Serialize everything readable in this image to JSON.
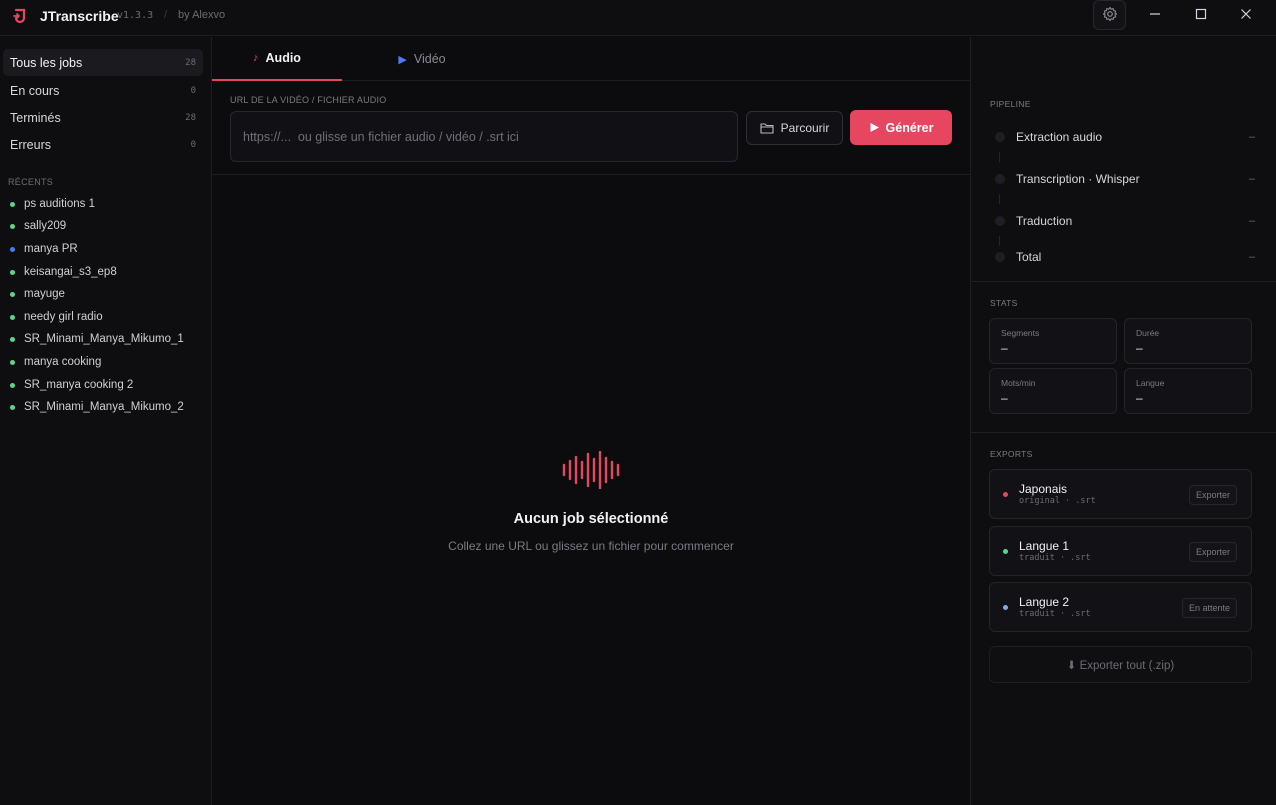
{
  "app": {
    "name": "JTranscribe",
    "version": "v1.3.3",
    "separator": "/",
    "author": "by Alexvo"
  },
  "colors": {
    "accent": "#e74660",
    "green": "#5cd68a",
    "blue": "#4a7cf0",
    "lightblue": "#8aa8f0"
  },
  "sidebar": {
    "nav": [
      {
        "label": "Tous les jobs",
        "count": "28"
      },
      {
        "label": "En cours",
        "count": "0"
      },
      {
        "label": "Terminés",
        "count": "28"
      },
      {
        "label": "Erreurs",
        "count": "0"
      }
    ],
    "recent_title": "RÉCENTS",
    "recent": [
      {
        "label": "ps auditions 1",
        "status": "green"
      },
      {
        "label": "sally209",
        "status": "green"
      },
      {
        "label": "manya PR",
        "status": "blue"
      },
      {
        "label": "keisangai_s3_ep8",
        "status": "green"
      },
      {
        "label": "mayuge",
        "status": "green"
      },
      {
        "label": "needy girl radio",
        "status": "green"
      },
      {
        "label": "SR_Minami_Manya_Mikumo_1",
        "status": "green"
      },
      {
        "label": "manya cooking",
        "status": "green"
      },
      {
        "label": "SR_manya cooking 2",
        "status": "green"
      },
      {
        "label": "SR_Minami_Manya_Mikumo_2",
        "status": "green"
      }
    ]
  },
  "main": {
    "tabs": [
      {
        "label": "Audio",
        "icon": "music-note-icon"
      },
      {
        "label": "Vidéo",
        "icon": "play-icon"
      }
    ],
    "url_label": "URL DE LA VIDÉO / FICHIER AUDIO",
    "url_placeholder": "https://...  ou glisse un fichier audio / vidéo / .srt ici",
    "browse_label": "Parcourir",
    "generate_label": "Générer",
    "empty_title": "Aucun job sélectionné",
    "empty_subtitle": "Collez une URL ou glissez un fichier pour commencer"
  },
  "right": {
    "pipeline_title": "PIPELINE",
    "pipeline": [
      {
        "label": "Extraction audio",
        "value": "–"
      },
      {
        "label": "Transcription · Whisper",
        "value": "–"
      },
      {
        "label": "Traduction",
        "value": "–"
      },
      {
        "label": "Total",
        "value": "–"
      }
    ],
    "stats_title": "STATS",
    "stats": [
      {
        "label": "Segments",
        "value": "–"
      },
      {
        "label": "Durée",
        "value": "–"
      },
      {
        "label": "Mots/min",
        "value": "–"
      },
      {
        "label": "Langue",
        "value": "–"
      }
    ],
    "exports_title": "EXPORTS",
    "exports": [
      {
        "name": "Japonais",
        "meta": "original · .srt",
        "action": "Exporter",
        "color": "#e74660"
      },
      {
        "name": "Langue 1",
        "meta": "traduit · .srt",
        "action": "Exporter",
        "color": "#5cd68a"
      },
      {
        "name": "Langue 2",
        "meta": "traduit · .srt",
        "action": "En attente",
        "color": "#8aa8f0"
      }
    ],
    "export_all_label": "⬇ Exporter tout (.zip)"
  }
}
